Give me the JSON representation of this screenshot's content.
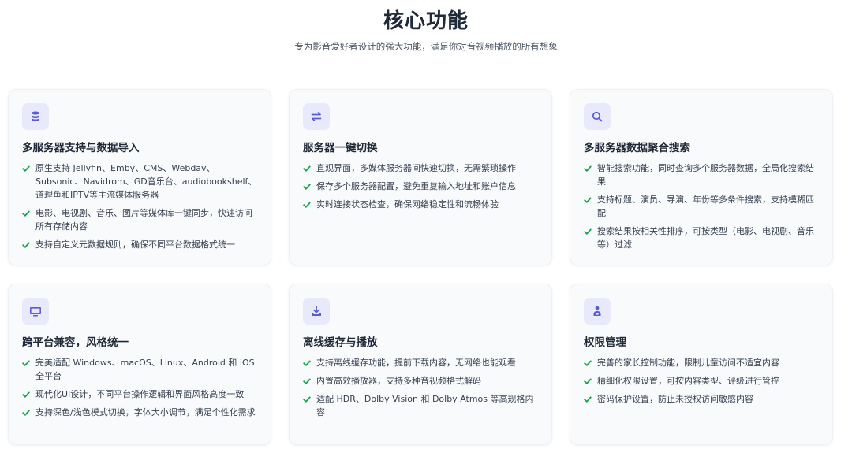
{
  "header": {
    "title": "核心功能",
    "subtitle": "专为影音爱好者设计的强大功能，满足你对音视频播放的所有想象"
  },
  "colors": {
    "accent": "#5b5bd6",
    "icon_bg": "#e8e9fb",
    "check": "#16a34a",
    "card_bg": "#f8fafc"
  },
  "features": [
    {
      "icon": "database-icon",
      "title": "多服务器支持与数据导入",
      "items": [
        "原生支持 Jellyfin、Emby、CMS、Webdav、Subsonic、Navidrom、GD音乐台、audiobookshelf、道理鱼和IPTV等主流媒体服务器",
        "电影、电视剧、音乐、图片等媒体库一键同步，快速访问所有存储内容",
        "支持自定义元数据规则，确保不同平台数据格式统一"
      ]
    },
    {
      "icon": "swap-arrows-icon",
      "title": "服务器一键切换",
      "items": [
        "直观界面，多媒体服务器间快速切换，无需繁琐操作",
        "保存多个服务器配置，避免重复输入地址和账户信息",
        "实时连接状态检查，确保网络稳定性和流畅体验"
      ]
    },
    {
      "icon": "search-icon",
      "title": "多服务器数据聚合搜索",
      "items": [
        "智能搜索功能，同时查询多个服务器数据，全局化搜索结果",
        "支持标题、演员、导演、年份等多条件搜索，支持模糊匹配",
        "搜索结果按相关性排序，可按类型（电影、电视剧、音乐等）过滤"
      ]
    },
    {
      "icon": "monitor-icon",
      "title": "跨平台兼容，风格统一",
      "items": [
        "完美适配 Windows、macOS、Linux、Android 和 iOS 全平台",
        "现代化UI设计，不同平台操作逻辑和界面风格高度一致",
        "支持深色/浅色模式切换，字体大小调节，满足个性化需求"
      ]
    },
    {
      "icon": "download-icon",
      "title": "离线缓存与播放",
      "items": [
        "支持离线缓存功能，提前下载内容，无网络也能观看",
        "内置高效播放器，支持多种音视频格式解码",
        "适配 HDR、Dolby Vision 和 Dolby Atmos 等高规格内容"
      ]
    },
    {
      "icon": "user-shield-icon",
      "title": "权限管理",
      "items": [
        "完善的家长控制功能，限制儿童访问不适宜内容",
        "精细化权限设置，可按内容类型、评级进行管控",
        "密码保护设置，防止未授权访问敏感内容"
      ]
    }
  ]
}
